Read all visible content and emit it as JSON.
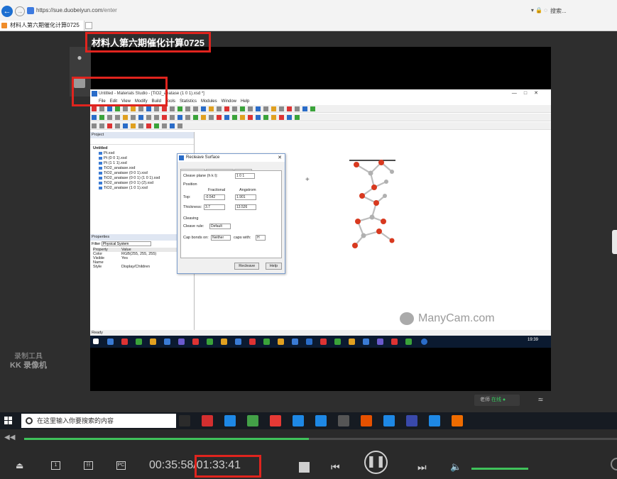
{
  "browser": {
    "url_host": "https://sue.duobeiyun.com",
    "url_path": "/enter",
    "secure_label": "▾ 🔒 ◌",
    "search_label": "搜索...",
    "tab_title": "材料人第六期催化计算0725"
  },
  "course": {
    "title": "材料人第六期催化计算0725"
  },
  "recorder": {
    "line1": "录制工具",
    "line2": "KK 录像机"
  },
  "ms": {
    "title": "Untitled - Materials Studio - [TiO2_anatase (1 0 1).xsd *]",
    "menu": [
      "File",
      "Edit",
      "View",
      "Modify",
      "Build",
      "Tools",
      "Statistics",
      "Modules",
      "Window",
      "Help"
    ],
    "project_header": "Project",
    "tree_root": "Untitled",
    "tree_items": [
      "Pt.xsd",
      "Pt (0 0 1).xsd",
      "Pt (1 1 1).xsd",
      "TiO2_anatase.xsd",
      "TiO2_anatase (0 0 1).xsd",
      "TiO2_anatase (0 0 1) (1 0 1).xsd",
      "TiO2_anatase (0 0 1) (2).xsd",
      "TiO2_anatase (1 0 1).xsd"
    ],
    "properties_header": "Properties",
    "filter_label": "Filter",
    "filter_value": "Physical System",
    "prop_col_property": "Property",
    "prop_col_value": "Value",
    "props": [
      {
        "k": "Color",
        "v": "RGB(255, 255, 255)"
      },
      {
        "k": "Visible",
        "v": "Yes"
      },
      {
        "k": "Name",
        "v": ""
      },
      {
        "k": "Style",
        "v": "Display/Children"
      }
    ],
    "status": "Ready",
    "taskbar_time": "19:39"
  },
  "dialog": {
    "title": "Recleave Surface",
    "tabs": [
      "Surface Box",
      "Surface Mesh",
      "Options"
    ],
    "cleave_plane_label": "Cleave plane (h k l):",
    "cleave_plane_value": "1 0 1",
    "position_label": "Position",
    "fractional_label": "Fractional",
    "angstrom_label": "Angstrom",
    "top_label": "Top:",
    "top_frac": "-0.542",
    "top_ang": "1.901",
    "thickness_label": "Thickness:",
    "thick_frac": "3.7",
    "thick_ang": "13.526",
    "cleaving_label": "Cleaving",
    "cleave_rule_label": "Cleave rule:",
    "cleave_rule_value": "Default",
    "cap_label": "Cap bonds on:",
    "cap_value": "Neither",
    "cap_with_label": "caps with:",
    "cap_with_value": "H",
    "recleave_btn": "Recleave",
    "help_btn": "Help"
  },
  "overlay": {
    "manycam": "ManyCam.com",
    "teacher_label": "老师",
    "teacher_status": "在线"
  },
  "host_taskbar": {
    "search_placeholder": "在这里输入你要搜索的内容",
    "icons": [
      "task-view",
      "adobe",
      "file-explorer",
      "chrome",
      "weibo",
      "baidu-netdisk",
      "skype",
      "media",
      "app-1",
      "app-2",
      "photos",
      "ie",
      "recorder"
    ]
  },
  "player": {
    "current_time": "00:35:58",
    "total_time": "/01:33:41",
    "progress": 0.48,
    "volume": 1.0,
    "ctrl_labels": {
      "one": "1",
      "pc": "PC"
    }
  },
  "colors": {
    "highlight_red": "#e0241e",
    "progress_green": "#3fc25a",
    "taskbar_dark": "#161b22"
  }
}
